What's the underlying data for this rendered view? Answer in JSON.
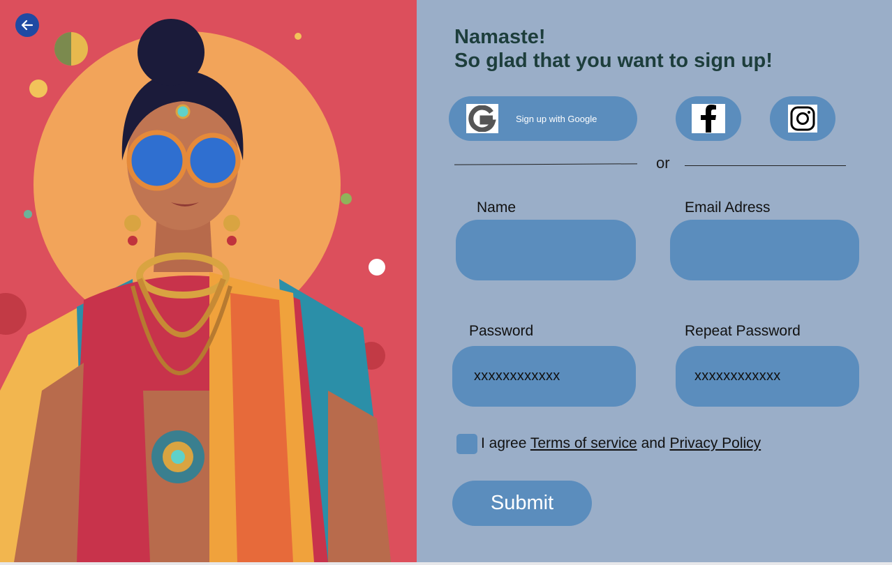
{
  "greeting": {
    "line1": "Namaste!",
    "line2": "So glad that you want to sign up!"
  },
  "social": {
    "google_label": "Sign up with Google",
    "google_icon": "google-icon",
    "facebook_icon": "facebook-icon",
    "instagram_icon": "instagram-icon"
  },
  "divider_text": "or",
  "form": {
    "name_label": "Name",
    "email_label": "Email Adress",
    "password_label": "Password",
    "password_value": "xxxxxxxxxxxx",
    "repeat_password_label": "Repeat Password",
    "repeat_password_value": "xxxxxxxxxxxx"
  },
  "agreement": {
    "prefix": "I agree",
    "terms": "Terms of service",
    "middle": "and",
    "privacy": "Privacy Policy"
  },
  "submit_label": "Submit",
  "colors": {
    "panel_bg": "#9aaec8",
    "control_blue": "#5b8dbd",
    "heading_green": "#1d3e3c",
    "back_button": "#1f4aa3",
    "hero_bg": "#dc4f5c"
  }
}
